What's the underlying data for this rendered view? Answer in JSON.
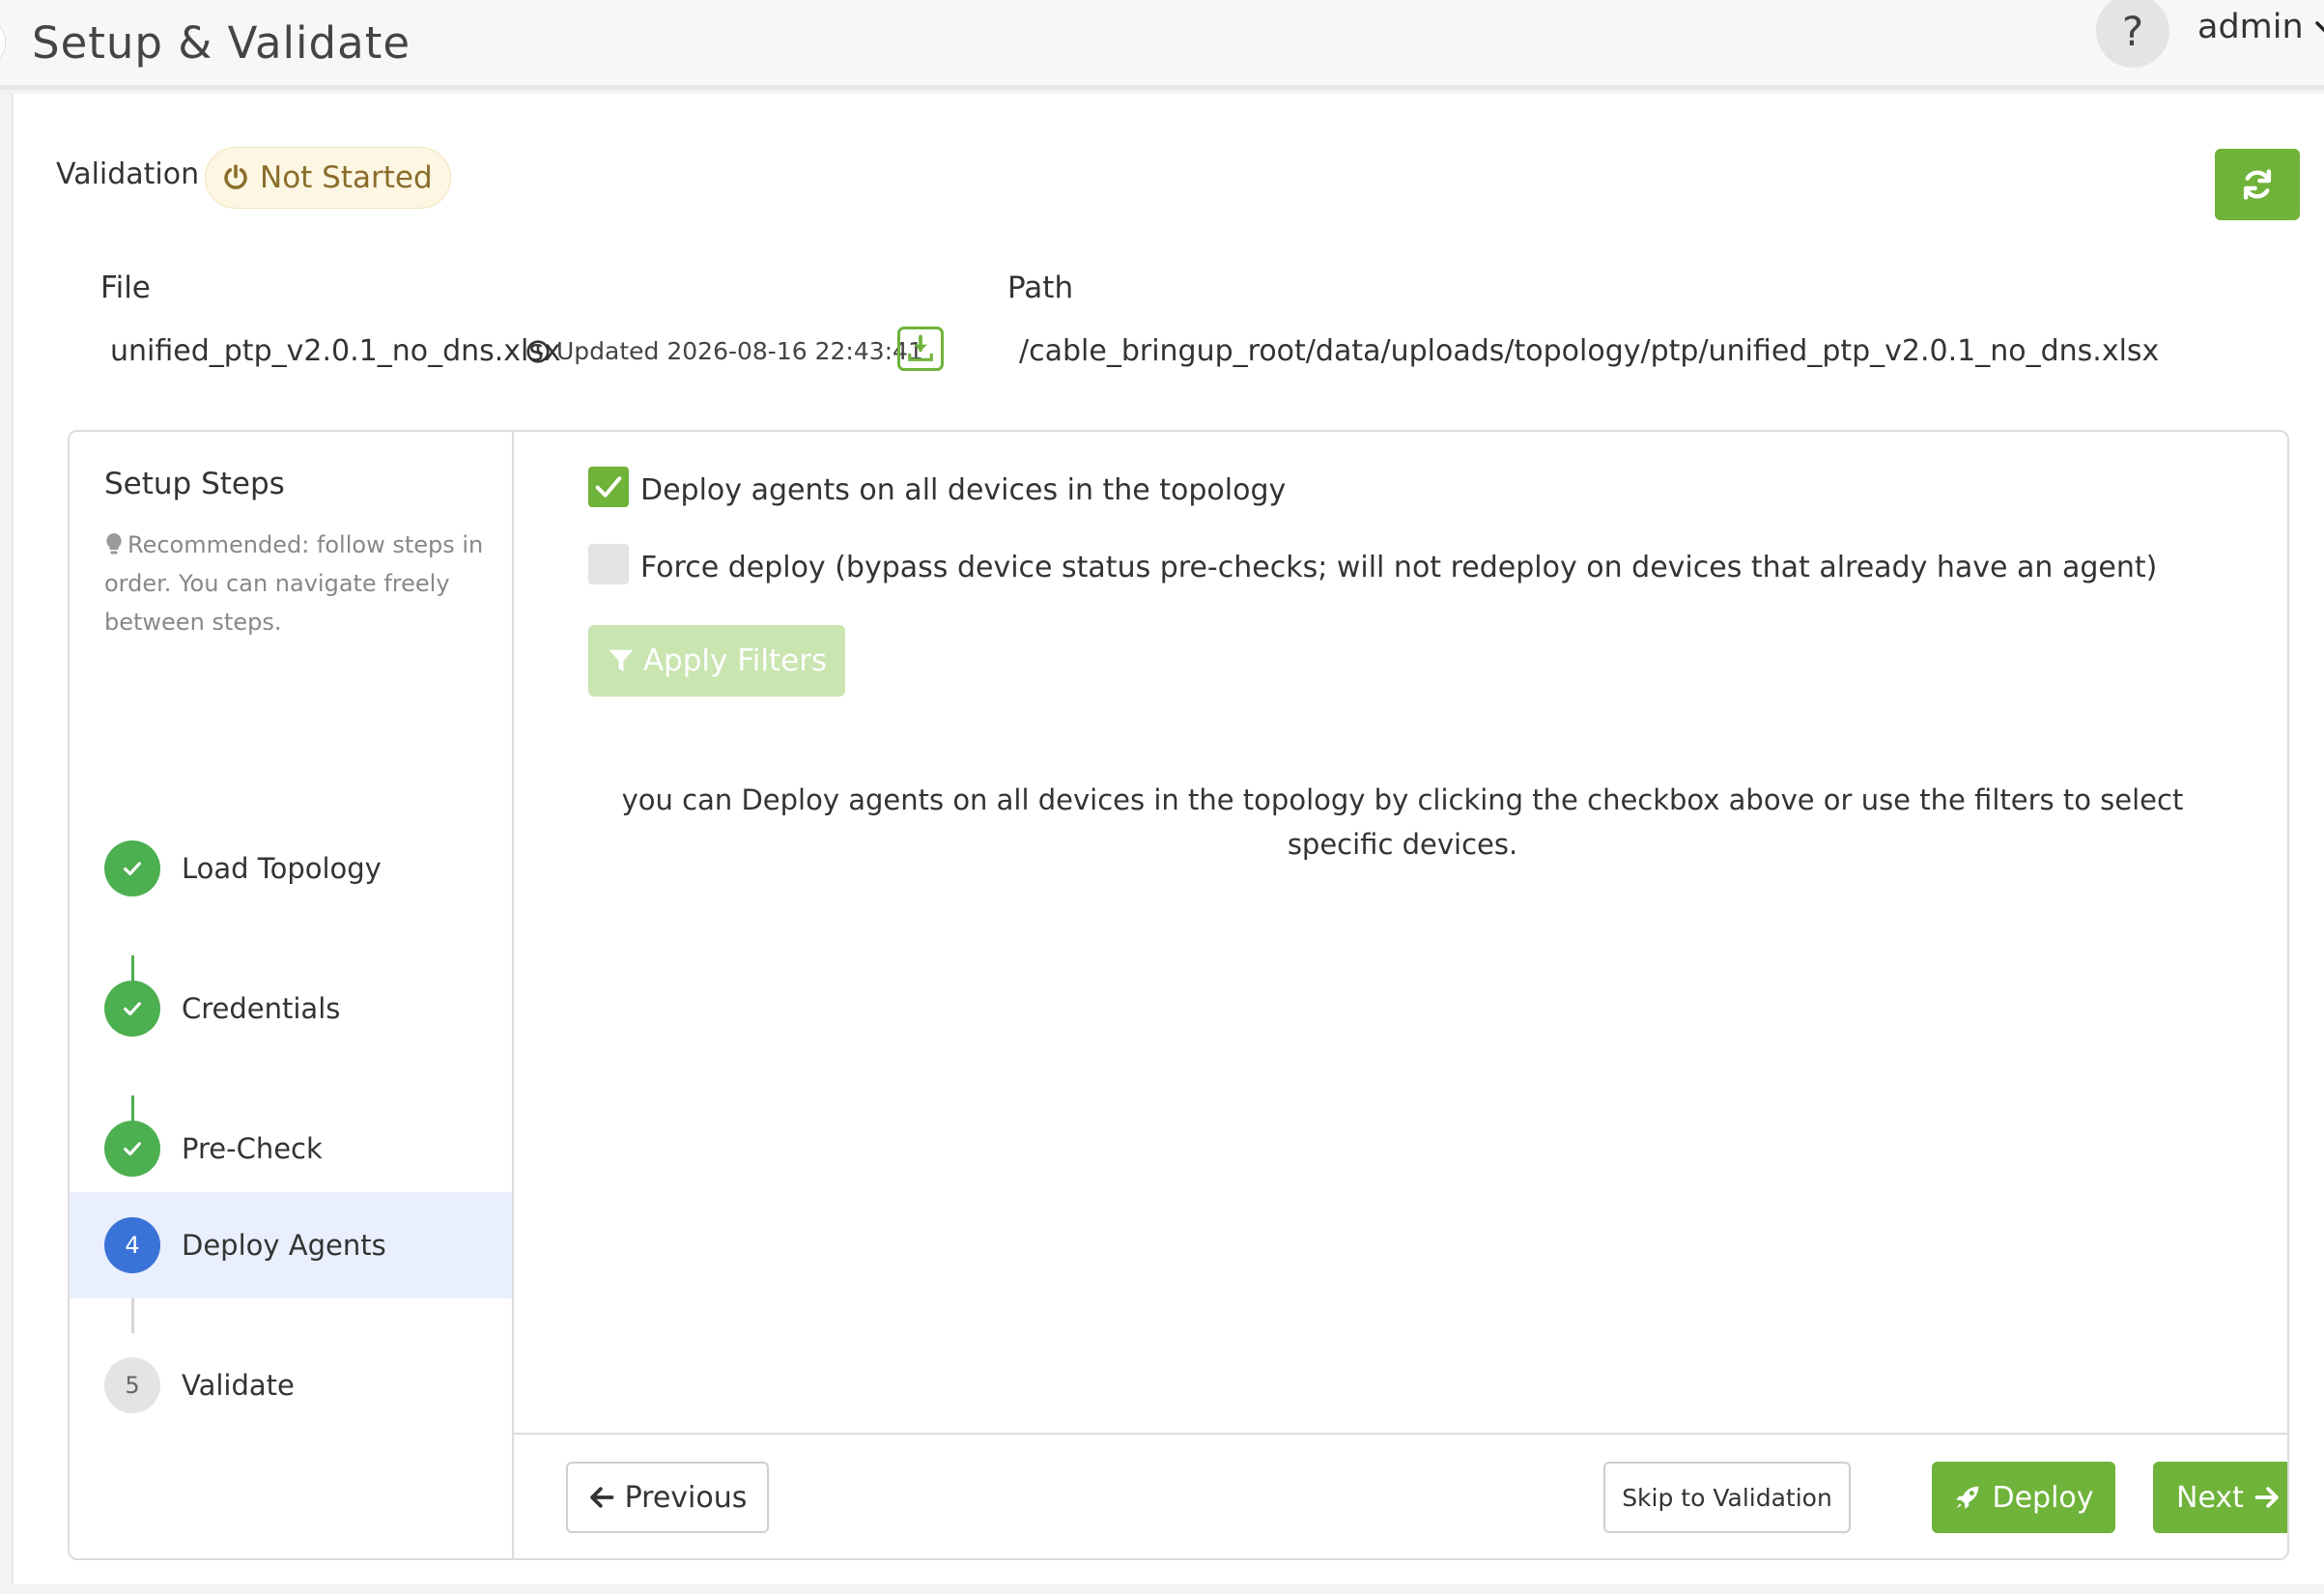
{
  "header": {
    "title": "Setup & Validate",
    "help_label": "?",
    "user": "admin"
  },
  "validation": {
    "label": "Validation",
    "status": "Not Started"
  },
  "file_info": {
    "file_label": "File",
    "file_name": "unified_ptp_v2.0.1_no_dns.xlsx",
    "updated": "Updated 2026-08-16 22:43:41",
    "path_label": "Path",
    "path": "/cable_bringup_root/data/uploads/topology/ptp/unified_ptp_v2.0.1_no_dns.xlsx"
  },
  "steps_panel": {
    "title": "Setup Steps",
    "hint": "Recommended: follow steps in order. You can navigate freely between steps.",
    "steps": [
      {
        "number": "1",
        "label": "Load Topology",
        "state": "done"
      },
      {
        "number": "2",
        "label": "Credentials",
        "state": "done"
      },
      {
        "number": "3",
        "label": "Pre-Check",
        "state": "done"
      },
      {
        "number": "4",
        "label": "Deploy Agents",
        "state": "current"
      },
      {
        "number": "5",
        "label": "Validate",
        "state": "pending"
      }
    ]
  },
  "deploy": {
    "all_devices_label": "Deploy agents on all devices in the topology",
    "all_devices_checked": true,
    "force_label": "Force deploy (bypass device status pre-checks; will not redeploy on devices that already have an agent)",
    "force_checked": false,
    "apply_filters_label": "Apply Filters",
    "info": "you can Deploy agents on all devices in the topology by clicking the checkbox above or use the filters to select specific devices."
  },
  "footer": {
    "previous_label": "Previous",
    "skip_label": "Skip to Validation",
    "deploy_label": "Deploy",
    "next_label": "Next"
  },
  "colors": {
    "accent_green": "#6fb33a",
    "step_done": "#4caf50",
    "step_current": "#3a73d8",
    "status_text": "#8a6d2b"
  },
  "icons": {
    "status": "power-icon",
    "refresh": "refresh-icon",
    "updated": "clock-icon",
    "download": "download-icon",
    "hint": "lightbulb-icon",
    "filter": "filter-icon",
    "previous": "arrow-left-icon",
    "deploy": "rocket-icon",
    "next": "arrow-right-icon"
  }
}
